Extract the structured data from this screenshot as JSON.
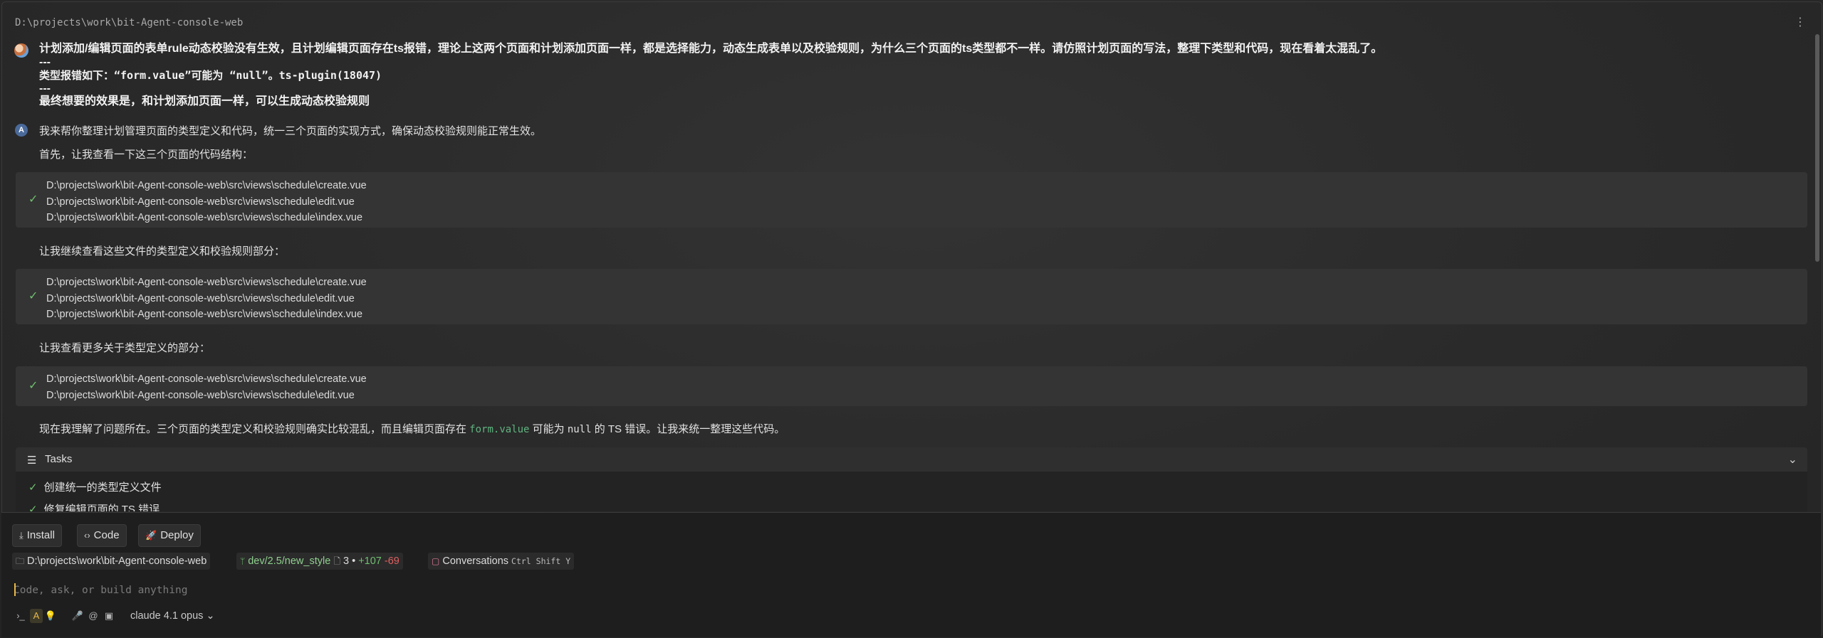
{
  "window": {
    "path_title": "D:\\projects\\work\\bit-Agent-console-web"
  },
  "user_message": {
    "lines": [
      "计划添加/编辑页面的表单rule动态校验没有生效，且计划编辑页面存在ts报错，理论上这两个页面和计划添加页面一样，都是选择能力，动态生成表单以及校验规则，为什么三个页面的ts类型都不一样。请仿照计划页面的写法，整理下类型和代码，现在看着太混乱了。",
      "---",
      "类型报错如下：“form.value”可能为 “null”。ts-plugin(18047)",
      "---",
      "最终想要的效果是，和计划添加页面一样，可以生成动态校验规则"
    ]
  },
  "assistant": {
    "intro": "我来帮你整理计划管理页面的类型定义和代码，统一三个页面的实现方式，确保动态校验规则能正常生效。",
    "step1": "首先，让我查看一下这三个页面的代码结构：",
    "files1": [
      "D:\\projects\\work\\bit-Agent-console-web\\src\\views\\schedule\\create.vue",
      "D:\\projects\\work\\bit-Agent-console-web\\src\\views\\schedule\\edit.vue",
      "D:\\projects\\work\\bit-Agent-console-web\\src\\views\\schedule\\index.vue"
    ],
    "step2": "让我继续查看这些文件的类型定义和校验规则部分：",
    "files2": [
      "D:\\projects\\work\\bit-Agent-console-web\\src\\views\\schedule\\create.vue",
      "D:\\projects\\work\\bit-Agent-console-web\\src\\views\\schedule\\edit.vue",
      "D:\\projects\\work\\bit-Agent-console-web\\src\\views\\schedule\\index.vue"
    ],
    "step3": "让我查看更多关于类型定义的部分：",
    "files3": [
      "D:\\projects\\work\\bit-Agent-console-web\\src\\views\\schedule\\create.vue",
      "D:\\projects\\work\\bit-Agent-console-web\\src\\views\\schedule\\edit.vue"
    ],
    "summary_before": "现在我理解了问题所在。三个页面的类型定义和校验规则确实比较混乱，而且编辑页面存在 ",
    "summary_code": "form.value",
    "summary_mid": " 可能为 ",
    "summary_null": "null",
    "summary_after": " 的 TS 错误。让我来统一整理这些代码。"
  },
  "tasks": {
    "title": "Tasks",
    "items": [
      {
        "label": "创建统一的类型定义文件",
        "done": true
      },
      {
        "label": "修复编辑页面的 TS 错误",
        "done": true
      }
    ]
  },
  "toolbar": {
    "install": "Install",
    "code": "Code",
    "deploy": "Deploy"
  },
  "context": {
    "folder": "D:\\projects\\work\\bit-Agent-console-web",
    "branch": "dev/2.5/new_style",
    "files_changed": "3",
    "additions": "+107",
    "deletions": "-69",
    "conversations": "Conversations",
    "shortcut": "Ctrl Shift Y"
  },
  "prompt": {
    "placeholder": "Code, ask, or build anything"
  },
  "model": {
    "name": "claude 4.1 opus"
  },
  "colors": {
    "accent_green": "#5fb37f",
    "check_green": "#6fbf6f",
    "caret_yellow": "#e8b84a",
    "deletion_red": "#e06060"
  }
}
